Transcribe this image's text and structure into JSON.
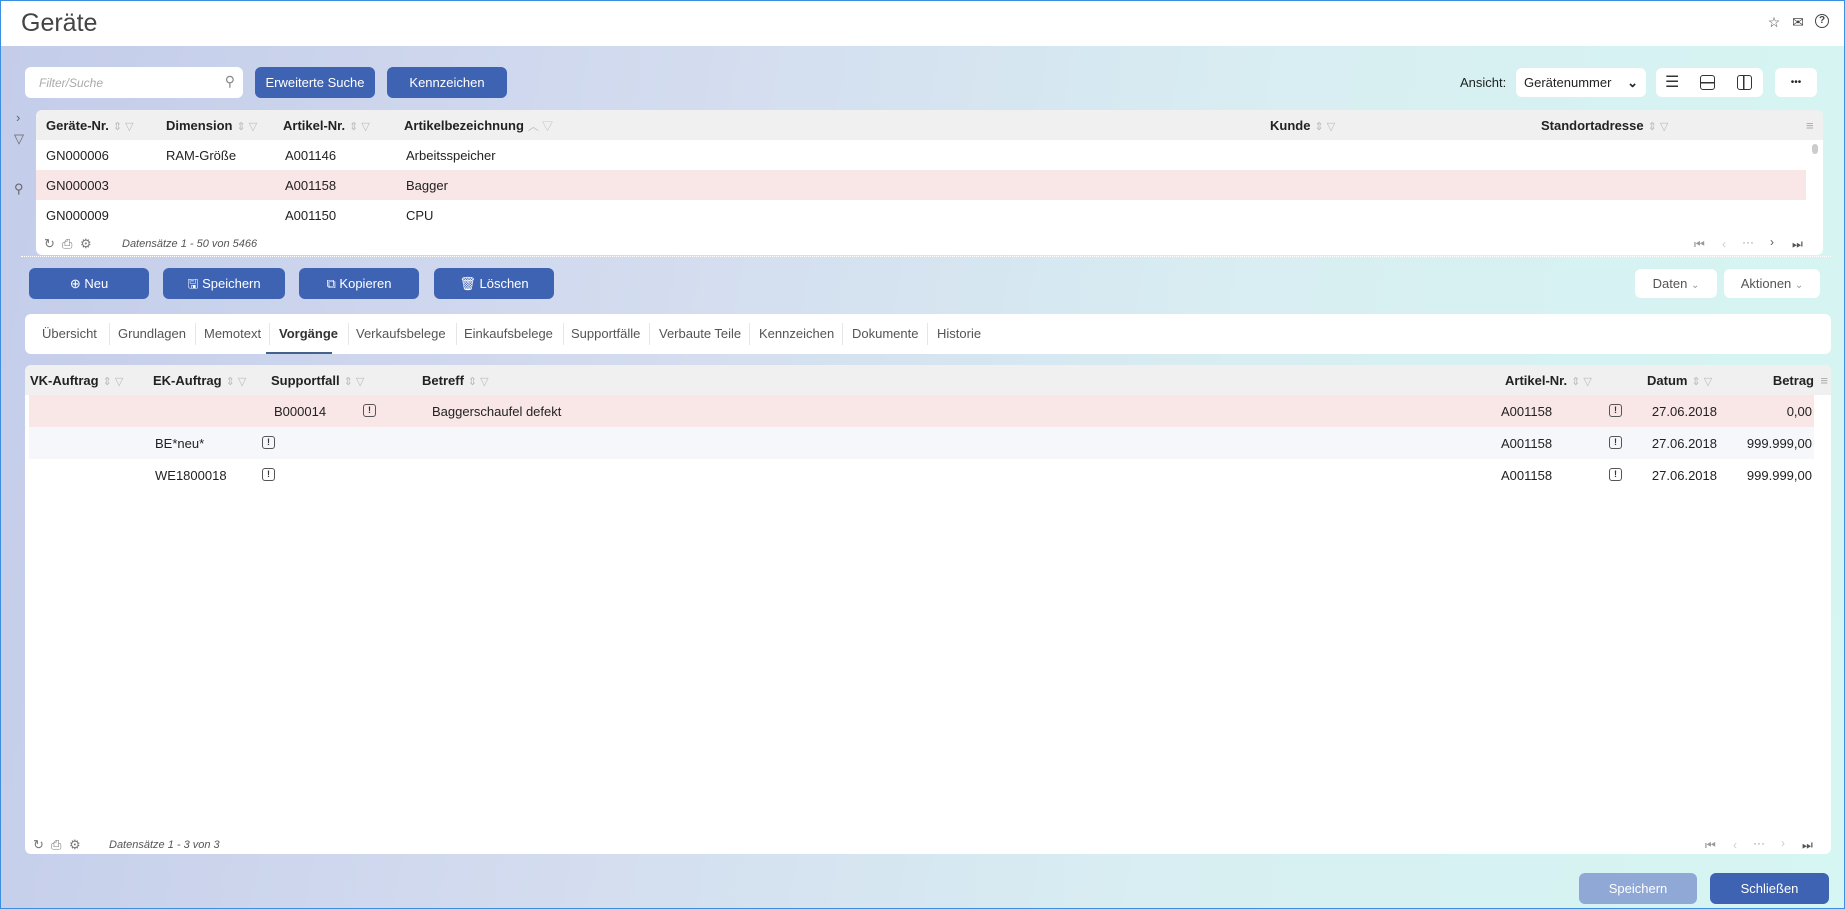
{
  "header": {
    "title": "Geräte",
    "icons": [
      "star-icon",
      "mail-icon",
      "help-icon"
    ]
  },
  "toolbar": {
    "search_placeholder": "Filter/Suche",
    "advanced_search": "Erweiterte Suche",
    "kennzeichen": "Kennzeichen",
    "view_label": "Ansicht:",
    "view_value": "Gerätenummer",
    "more": "•••"
  },
  "top_grid": {
    "columns": [
      "Geräte-Nr.",
      "Dimension",
      "Artikel-Nr.",
      "Artikelbezeichnung",
      "Kunde",
      "Standortadresse"
    ],
    "rows": [
      [
        "GN000006",
        "RAM-Größe",
        "A001146",
        "Arbeitsspeicher",
        "",
        ""
      ],
      [
        "GN000003",
        "",
        "A001158",
        "Bagger",
        "",
        ""
      ],
      [
        "GN000009",
        "",
        "A001150",
        "CPU",
        "",
        ""
      ]
    ],
    "footer": "Datensätze 1 - 50 von 5466"
  },
  "actions": {
    "new": "Neu",
    "save": "Speichern",
    "copy": "Kopieren",
    "delete": "Löschen",
    "data": "Daten",
    "actions": "Aktionen"
  },
  "tabs": [
    "Übersicht",
    "Grundlagen",
    "Memotext",
    "Vorgänge",
    "Verkaufsbelege",
    "Einkaufsbelege",
    "Supportfälle",
    "Verbaute Teile",
    "Kennzeichen",
    "Dokumente",
    "Historie"
  ],
  "active_tab": "Vorgänge",
  "bottom_grid": {
    "columns": [
      "VK-Auftrag",
      "EK-Auftrag",
      "Supportfall",
      "Betreff",
      "Artikel-Nr.",
      "Datum",
      "Betrag"
    ],
    "rows": [
      {
        "vk": "",
        "ek": "",
        "support": "B000014",
        "betreff": "Baggerschaufel defekt",
        "artikel": "A001158",
        "datum": "27.06.2018",
        "betrag": "0,00"
      },
      {
        "vk": "",
        "ek": "BE*neu*",
        "support": "",
        "betreff": "",
        "artikel": "A001158",
        "datum": "27.06.2018",
        "betrag": "999.999,00"
      },
      {
        "vk": "",
        "ek": "WE1800018",
        "support": "",
        "betreff": "",
        "artikel": "A001158",
        "datum": "27.06.2018",
        "betrag": "999.999,00"
      }
    ],
    "footer": "Datensätze 1 - 3 von 3"
  },
  "footer": {
    "save": "Speichern",
    "close": "Schließen"
  },
  "colors": {
    "primary": "#3f63b3",
    "highlight_row": "#f9e6e6",
    "alt_row": "#f6f7fb"
  }
}
